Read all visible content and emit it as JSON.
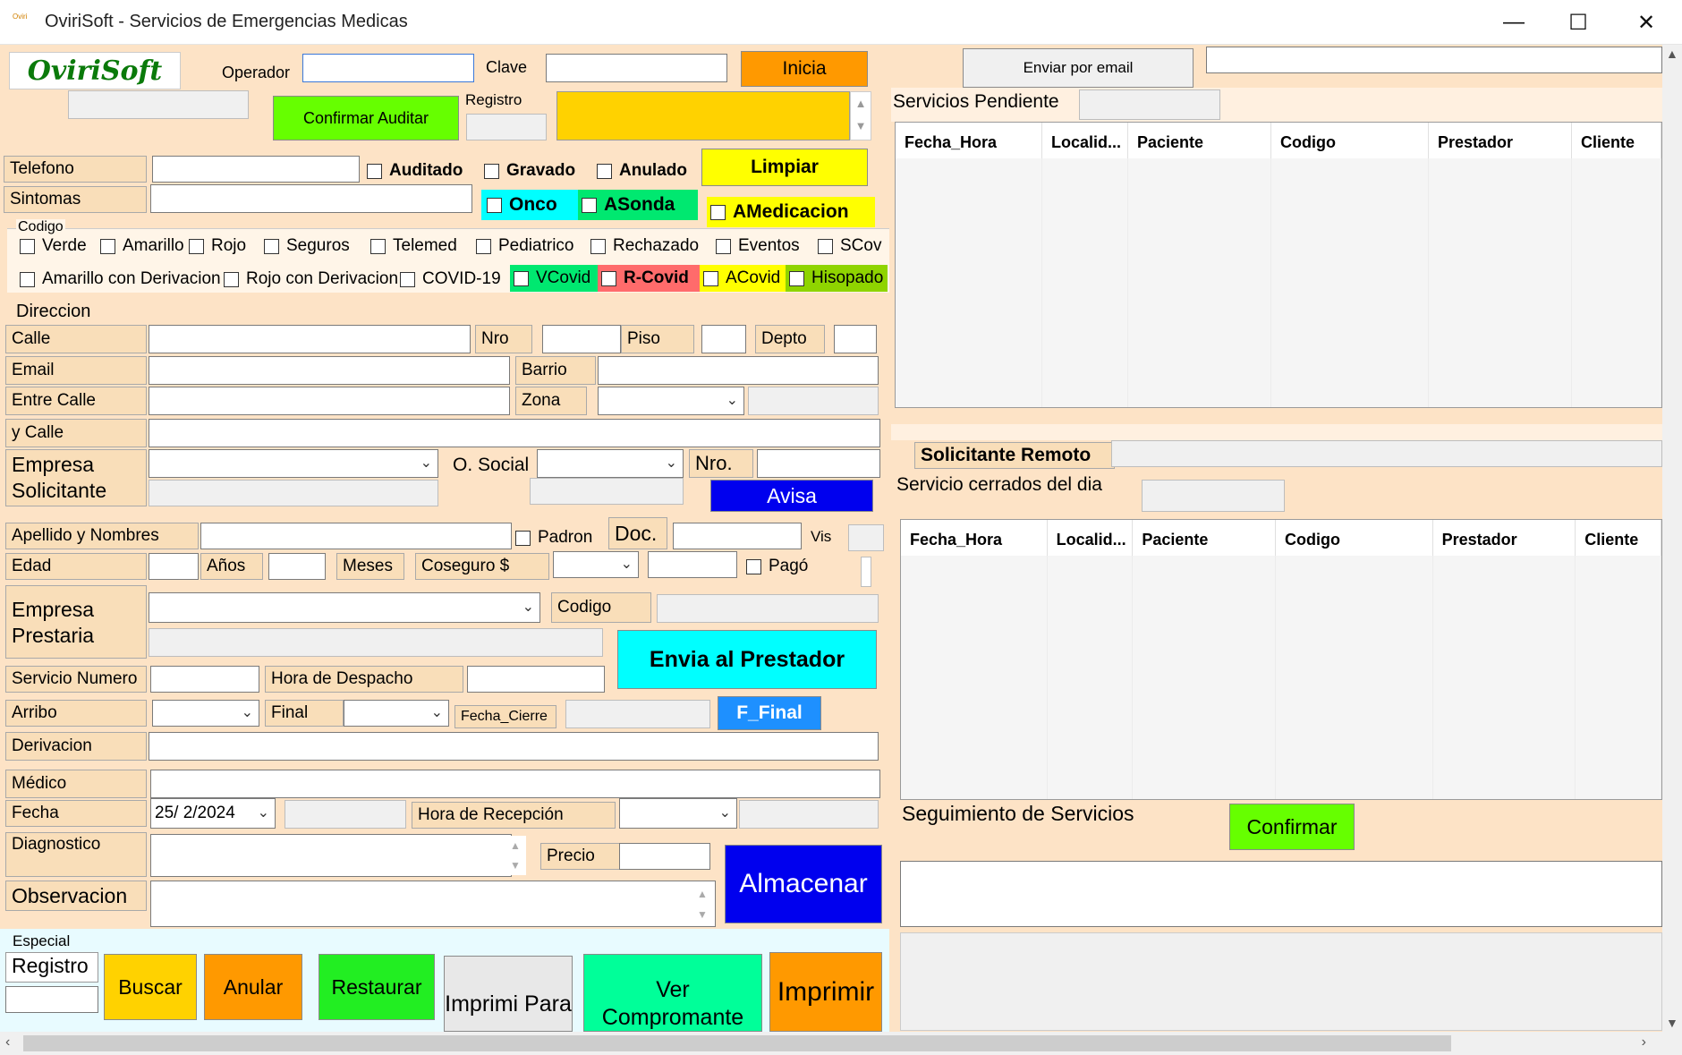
{
  "window": {
    "title": "OviriSoft - Servicios de Emergencias Medicas",
    "icon_text": "Oviri",
    "minimize": "—",
    "maximize": "☐",
    "close": "✕"
  },
  "header": {
    "logo": "OviriSoft",
    "operador_label": "Operador",
    "clave_label": "Clave",
    "inicia_button": "Inicia",
    "confirmar_auditar_button": "Confirmar Auditar",
    "registro_label": "Registro"
  },
  "checks_top": {
    "auditado": "Auditado",
    "gravado": "Gravado",
    "anulado": "Anulado",
    "onco": "Onco",
    "asonda": "ASonda",
    "amedicacion": "AMedicacion"
  },
  "limpiar_button": "Limpiar",
  "fields": {
    "telefono": "Telefono",
    "sintomas": "Sintomas"
  },
  "codigo": {
    "legend": "Codigo",
    "row1": [
      "Verde",
      "Amarillo",
      "Rojo",
      "Seguros",
      "Telemed",
      "Pediatrico",
      "Rechazado",
      "Eventos",
      "SCov"
    ],
    "row2": [
      "Amarillo con Derivacion",
      "Rojo con Derivacion",
      "COVID-19",
      "VCovid",
      "R-Covid",
      "ACovid",
      "Hisopado"
    ]
  },
  "direccion": {
    "legend": "Direccion",
    "calle": "Calle",
    "nro": "Nro",
    "piso": "Piso",
    "depto": "Depto",
    "email": "Email",
    "barrio": "Barrio",
    "entre_calle": "Entre Calle",
    "zona": "Zona",
    "y_calle": "y Calle"
  },
  "empresa_solicitante": {
    "label": "Empresa Solicitante",
    "osocial_label": "O. Social",
    "nro_label": "Nro.",
    "avisa_button": "Avisa"
  },
  "paciente": {
    "apellido_nombres": "Apellido y Nombres",
    "padron": "Padron",
    "doc": "Doc.",
    "vis": "Vis",
    "edad": "Edad",
    "anios": "Años",
    "meses": "Meses",
    "coseguro": "Coseguro $",
    "pago": "Pagó"
  },
  "empresa_prestaria": {
    "label": "Empresa Prestaria",
    "codigo_label": "Codigo",
    "envia_button": "Envia al Prestador"
  },
  "servicio": {
    "servicio_numero": "Servicio Numero",
    "hora_despacho": "Hora de Despacho",
    "arribo": "Arribo",
    "final": "Final",
    "fecha_cierre": "Fecha_Cierre",
    "f_final_button": "F_Final",
    "derivacion": "Derivacion",
    "medico": "Médico",
    "fecha": "Fecha",
    "fecha_value": "25/  2/2024",
    "hora_recepcion": "Hora de Recepción",
    "diagnostico": "Diagnostico",
    "precio": "Precio",
    "almacenar_button": "Almacenar",
    "observacion": "Observacion"
  },
  "bottom": {
    "especial_legend": "Especial",
    "registro_label": "Registro",
    "buscar": "Buscar",
    "anular": "Anular",
    "restaurar": "Restaurar",
    "imprimi_para": "Imprimi Para",
    "ver_compromante": "Ver Compromante",
    "imprimir": "Imprimir"
  },
  "right": {
    "enviar_email_button": "Enviar por email",
    "servicios_pendiente": "Servicios  Pendiente",
    "grid_columns": [
      "Fecha_Hora",
      "Localid...",
      "Paciente",
      "Codigo",
      "Prestador",
      "Cliente"
    ],
    "solicitante_remoto": "Solicitante Remoto",
    "servicio_cerrados": "Servicio cerrados del dia",
    "seguimiento": "Seguimiento de Servicios",
    "confirmar_button": "Confirmar"
  },
  "colors": {
    "panel": "#fde3c6",
    "label": "#f9deb9",
    "inicia": "#ff9900",
    "confirm_green": "#66ff00",
    "yellow": "#ffff00",
    "cyan": "#00ffff",
    "blue": "#0000ee"
  }
}
